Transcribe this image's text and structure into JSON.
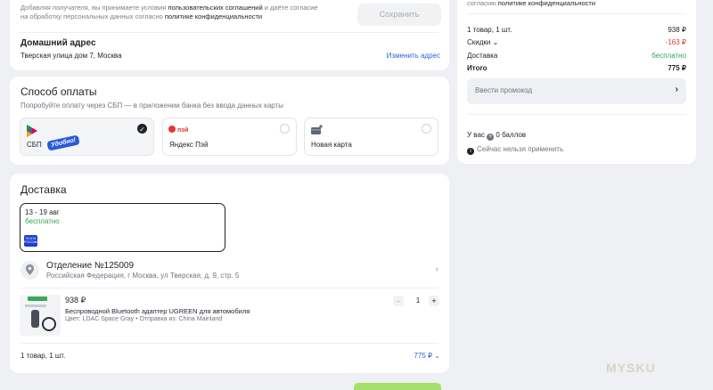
{
  "consent": {
    "text_pre": "Добавляя получателя, вы принимаете условия ",
    "user_agreements": "пользовательских соглашений",
    "text_mid": " и даёте согласие на обработку персональных данных согласно ",
    "privacy_policy": "политике конфиденциальности"
  },
  "save_button": "Сохранить",
  "home": {
    "title": "Домашний адрес",
    "address": "Тверская улица дом 7, Москва",
    "change": "Изменить адрес"
  },
  "payment": {
    "title": "Способ оплаты",
    "description": "Попробуйте оплату через СБП — в приложении банка без ввода данных карты",
    "options": [
      {
        "label": "СБП",
        "badge": "Удобно!",
        "selected": true,
        "icon": "sbp-icon"
      },
      {
        "label": "Яндекс Пэй",
        "logo_text": "пэй",
        "selected": false,
        "icon": "yandex-pay-icon"
      },
      {
        "label": "Новая карта",
        "selected": false,
        "icon": "card-plus-icon"
      }
    ]
  },
  "delivery": {
    "title": "Доставка",
    "date_range": "13 - 19 авг",
    "price": "бесплатно",
    "carrier_logo": "ПОЧТА РОССИИ",
    "office_title": "Отделение №125009",
    "office_address": "Российская Федерация, г Москва, ул Тверская, д. 9, стр. 5",
    "product": {
      "price": "938 ₽",
      "name": "Беспроводной Bluetooth адаптер UGREEN для автомобиля",
      "meta": "Цвет: LDAC Space Gray • Отправка из: China Mainland",
      "qty": "1",
      "minus": "-",
      "plus": "+"
    },
    "count": "1 товар, 1 шт.",
    "sum": "775 ₽"
  },
  "summary": {
    "consent_pre": "согласию ",
    "consent_link": "политике конфиденциальности",
    "rows": [
      {
        "label": "1 товар, 1 шт.",
        "value": "938 ₽"
      },
      {
        "label": "Скидки",
        "value": "-163 ₽"
      },
      {
        "label": "Доставка",
        "value": "бесплатно"
      },
      {
        "label": "Итого",
        "value": "775 ₽"
      }
    ],
    "promo_placeholder": "Ввести промокод",
    "points_pre": "У вас",
    "points_val": "0 баллов",
    "cant_use": "Сейчас нельзя применить"
  },
  "colors": {
    "accent": "#2f62d6",
    "green": "#2fa84f",
    "red": "#e5372e",
    "badge": "#2a5bd7"
  },
  "watermark": "MYSKU"
}
